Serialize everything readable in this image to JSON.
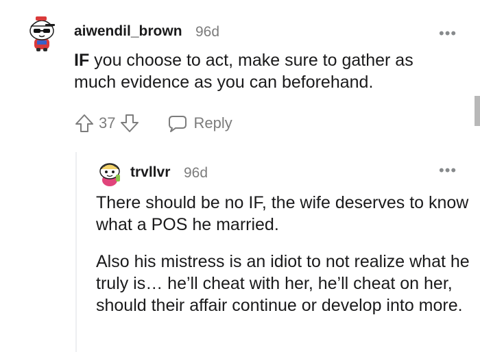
{
  "comment": {
    "username": "aiwendil_brown",
    "time": "96d",
    "more": "•••",
    "body_bold": "IF",
    "body_rest": " you choose to act, make sure to gather as much evidence as you can beforehand.",
    "score": "37",
    "reply_label": "Reply"
  },
  "reply": {
    "username": "trvllvr",
    "time": "96d",
    "more": "•••",
    "paragraphs": [
      "There should be no IF, the wife deserves to know what a POS he married.",
      "Also his mistress is an idiot to not realize what he truly is… he’ll cheat with her, he’ll cheat on her, should their affair continue or develop into more."
    ]
  },
  "icons": {
    "upvote": "upvote-icon",
    "downvote": "downvote-icon",
    "reply": "speech-bubble-icon",
    "more": "more-options-icon"
  },
  "colors": {
    "text": "#1a1a1b",
    "meta": "#7c7c7c",
    "thread_line": "#edeff1"
  }
}
